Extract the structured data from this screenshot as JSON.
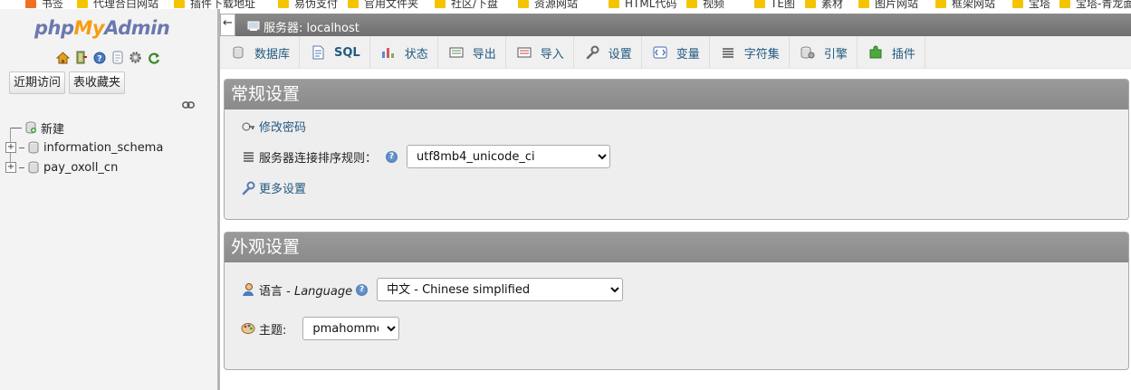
{
  "bookmarks": [
    "书签",
    "代理合白网站",
    "插件下载地址",
    "易伪支付",
    "官用文件夹",
    "社区/下盘",
    "资源网站",
    "HTML代码",
    "视频",
    "TE图",
    "素材",
    "图片网站",
    "框架网站",
    "宝塔",
    "宝塔-青龙面"
  ],
  "logo": {
    "part1": "php",
    "part2": "My",
    "part3": "Admin"
  },
  "nav": {
    "icons": [
      "home-icon",
      "logout-icon",
      "help-icon",
      "docs-icon",
      "settings-icon",
      "reload-icon"
    ],
    "recent_label": "近期访问",
    "favorites_label": "表收藏夹",
    "tree": [
      {
        "label": "新建",
        "kind": "new"
      },
      {
        "label": "information_schema",
        "kind": "db"
      },
      {
        "label": "pay_oxoll_cn",
        "kind": "db"
      }
    ]
  },
  "server": {
    "label": "服务器: localhost",
    "collapse_symbol": "←"
  },
  "tabs": [
    {
      "label": "数据库",
      "icon": "database-icon"
    },
    {
      "label": "SQL",
      "icon": "sql-icon"
    },
    {
      "label": "状态",
      "icon": "status-icon"
    },
    {
      "label": "导出",
      "icon": "export-icon"
    },
    {
      "label": "导入",
      "icon": "import-icon"
    },
    {
      "label": "设置",
      "icon": "wrench-icon"
    },
    {
      "label": "变量",
      "icon": "variables-icon"
    },
    {
      "label": "字符集",
      "icon": "charset-icon"
    },
    {
      "label": "引擎",
      "icon": "engine-icon"
    },
    {
      "label": "插件",
      "icon": "plugin-icon"
    }
  ],
  "general": {
    "title": "常规设置",
    "change_password": "修改密码",
    "collation_label": "服务器连接排序规则：",
    "collation_value": "utf8mb4_unicode_ci",
    "more_settings": "更多设置"
  },
  "appearance": {
    "title": "外观设置",
    "language_label": "语言 - ",
    "language_label_en": "Language",
    "language_value": "中文 - Chinese simplified",
    "theme_label": "主题:",
    "theme_value": "pmahomme"
  },
  "colors": {
    "link": "#235a81",
    "panel_header": "#8f8f8f",
    "server_bar": "#7a7a7a"
  }
}
